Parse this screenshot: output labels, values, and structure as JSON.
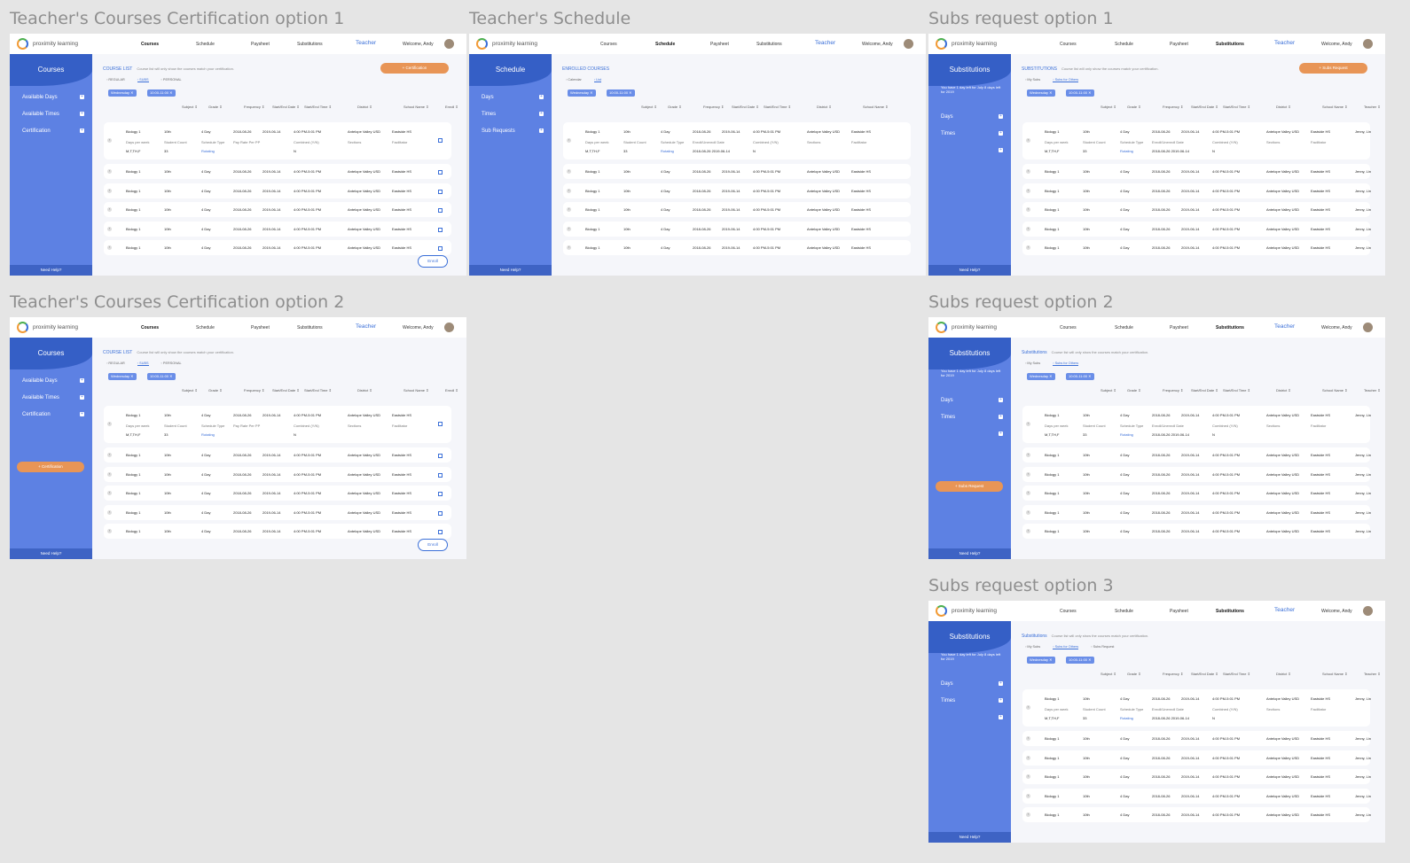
{
  "boards": [
    {
      "title": "Teacher's Courses Certification option 1",
      "nav": [
        "Courses",
        "Schedule",
        "Paysheet",
        "Substitutions"
      ],
      "active_nav": 0,
      "role": "Teacher",
      "welcome": "Welcome, Andy",
      "sidebar": {
        "title": "Courses",
        "note": "",
        "items": [
          "Available Days",
          "Available Times",
          "Certification"
        ],
        "button": ""
      },
      "section_title": "COURSE LIST",
      "section_note": "Course list will only show the courses match your certification.",
      "top_button": "+ Certification",
      "tabs": [
        "REGULAR",
        "SUBS",
        "PERSONAL"
      ],
      "active_tab": 1,
      "chips": [
        "Wednesday",
        "10:00-11:00"
      ],
      "columns": [
        "Subject",
        "Grade",
        "Frequency",
        "Start/End Date",
        "Start/End Time",
        "District",
        "School Name",
        "Enroll"
      ],
      "expanded": {
        "row": [
          "Biology 1",
          "10th",
          "4 Day",
          "2018-08-26",
          "2019-06-14",
          "4:00 PM-5:01 PM",
          "Antelope Valley USD",
          "Eastside HS"
        ],
        "labels": [
          "Days per week",
          "Student Count",
          "Schedule Type",
          "Pay Rate Per PP",
          "Combined (Y/N)",
          "Sections",
          "Facilitator"
        ],
        "values": [
          "M,T,TH,F",
          "33",
          "Rotating",
          "",
          "N",
          "",
          ""
        ]
      },
      "rows": [
        [
          "Biology 1",
          "10th",
          "4 Day",
          "2018-08-26",
          "2019-06-14",
          "4:00 PM-5:01 PM",
          "Antelope Valley USD",
          "Eastside HS"
        ],
        [
          "Biology 1",
          "10th",
          "4 Day",
          "2018-08-26",
          "2019-06-14",
          "4:00 PM-5:01 PM",
          "Antelope Valley USD",
          "Eastside HS"
        ],
        [
          "Biology 1",
          "10th",
          "4 Day",
          "2018-08-26",
          "2019-06-14",
          "4:00 PM-5:01 PM",
          "Antelope Valley USD",
          "Eastside HS"
        ],
        [
          "Biology 1",
          "10th",
          "4 Day",
          "2018-08-26",
          "2019-06-14",
          "4:00 PM-5:01 PM",
          "Antelope Valley USD",
          "Eastside HS"
        ],
        [
          "Biology 1",
          "10th",
          "4 Day",
          "2018-08-26",
          "2019-06-14",
          "4:00 PM-5:01 PM",
          "Antelope Valley USD",
          "Eastside HS"
        ]
      ],
      "checkbox": true,
      "enroll": "Enroll",
      "need_help": "Need Help?"
    },
    {
      "title": "Teacher's Schedule",
      "nav": [
        "Courses",
        "Schedule",
        "Paysheet",
        "Substitutions"
      ],
      "active_nav": 1,
      "role": "Teacher",
      "welcome": "Welcome, Andy",
      "sidebar": {
        "title": "Schedule",
        "note": "",
        "items": [
          "Days",
          "Times",
          "Sub Requests"
        ],
        "button": ""
      },
      "section_title": "ENROLLED COURSES",
      "section_note": "",
      "top_button": "",
      "tabs": [
        "Calendar",
        "List"
      ],
      "active_tab": 1,
      "chips": [
        "Wednesday",
        "10:00-11:00"
      ],
      "columns": [
        "Subject",
        "Grade",
        "Frequency",
        "Start/End Date",
        "Start/End Time",
        "District",
        "School Name"
      ],
      "expanded": {
        "row": [
          "Biology 1",
          "10th",
          "4 Day",
          "2018-08-26",
          "2019-06-14",
          "4:00 PM-5:01 PM",
          "Antelope Valley USD",
          "Eastside HS"
        ],
        "labels": [
          "Days per week",
          "Student Count",
          "Schedule Type",
          "Enroll/Unenroll Date",
          "Combined (Y/N)",
          "Sections",
          "Facilitator"
        ],
        "values": [
          "M,T,TH,F",
          "33",
          "Rotating",
          "2018-08-26  2019-06-14",
          "N",
          "",
          ""
        ]
      },
      "rows": [
        [
          "Biology 1",
          "10th",
          "4 Day",
          "2018-08-26",
          "2019-06-14",
          "4:00 PM-5:01 PM",
          "Antelope Valley USD",
          "Eastside HS"
        ],
        [
          "Biology 1",
          "10th",
          "4 Day",
          "2018-08-26",
          "2019-06-14",
          "4:00 PM-5:01 PM",
          "Antelope Valley USD",
          "Eastside HS"
        ],
        [
          "Biology 1",
          "10th",
          "4 Day",
          "2018-08-26",
          "2019-06-14",
          "4:00 PM-5:01 PM",
          "Antelope Valley USD",
          "Eastside HS"
        ],
        [
          "Biology 1",
          "10th",
          "4 Day",
          "2018-08-26",
          "2019-06-14",
          "4:00 PM-5:01 PM",
          "Antelope Valley USD",
          "Eastside HS"
        ],
        [
          "Biology 1",
          "10th",
          "4 Day",
          "2018-08-26",
          "2019-06-14",
          "4:00 PM-5:01 PM",
          "Antelope Valley USD",
          "Eastside HS"
        ]
      ],
      "checkbox": false,
      "enroll": "",
      "need_help": "Need Help?"
    },
    {
      "title": "Subs request option 1",
      "nav": [
        "Courses",
        "Schedule",
        "Paysheet",
        "Substitutions"
      ],
      "active_nav": 3,
      "role": "Teacher",
      "welcome": "Welcome, Andy",
      "sidebar": {
        "title": "Substitutions",
        "note": "You have 1 day left for July 8 days left for 2019",
        "items": [
          "Days",
          "Times",
          ""
        ],
        "button": ""
      },
      "section_title": "SUBSTITUTIONS",
      "section_note": "Course list will only show the courses match your certification.",
      "top_button": "+ Subs Request",
      "tabs": [
        "My Subs",
        "Subs for Others"
      ],
      "active_tab": 1,
      "chips": [
        "Wednesday",
        "10:00-11:00"
      ],
      "columns": [
        "Subject",
        "Grade",
        "Frequency",
        "Start/End Date",
        "Start/End Time",
        "District",
        "School Name",
        "Teacher"
      ],
      "expanded": {
        "row": [
          "Biology 1",
          "10th",
          "4 Day",
          "2018-08-26",
          "2019-06-14",
          "4:00 PM-5:01 PM",
          "Antelope Valley USD",
          "Eastside HS",
          "Jenny, Lin"
        ],
        "labels": [
          "Days per week",
          "Student Count",
          "Schedule Type",
          "Enroll/Unenroll Date",
          "Combined (Y/N)",
          "Sections",
          "Facilitator"
        ],
        "values": [
          "M,T,TH,F",
          "33",
          "Rotating",
          "2018-08-26  2019-06-14",
          "N",
          "",
          ""
        ]
      },
      "rows": [
        [
          "Biology 1",
          "10th",
          "4 Day",
          "2018-08-26",
          "2019-06-14",
          "4:00 PM-5:01 PM",
          "Antelope Valley USD",
          "Eastside HS",
          "Jenny, Lin"
        ],
        [
          "Biology 1",
          "10th",
          "4 Day",
          "2018-08-26",
          "2019-06-14",
          "4:00 PM-5:01 PM",
          "Antelope Valley USD",
          "Eastside HS",
          "Jenny, Lin"
        ],
        [
          "Biology 1",
          "10th",
          "4 Day",
          "2018-08-26",
          "2019-06-14",
          "4:00 PM-5:01 PM",
          "Antelope Valley USD",
          "Eastside HS",
          "Jenny, Lin"
        ],
        [
          "Biology 1",
          "10th",
          "4 Day",
          "2018-08-26",
          "2019-06-14",
          "4:00 PM-5:01 PM",
          "Antelope Valley USD",
          "Eastside HS",
          "Jenny, Lin"
        ],
        [
          "Biology 1",
          "10th",
          "4 Day",
          "2018-08-26",
          "2019-06-14",
          "4:00 PM-5:01 PM",
          "Antelope Valley USD",
          "Eastside HS",
          "Jenny, Lin"
        ]
      ],
      "checkbox": false,
      "enroll": "",
      "need_help": "Need Help?"
    },
    {
      "title": "Teacher's Courses Certification option 2",
      "nav": [
        "Courses",
        "Schedule",
        "Paysheet",
        "Substitutions"
      ],
      "active_nav": 0,
      "role": "Teacher",
      "welcome": "Welcome, Andy",
      "sidebar": {
        "title": "Courses",
        "note": "",
        "items": [
          "Available Days",
          "Available Times",
          "Certification"
        ],
        "button": "+ Certification"
      },
      "section_title": "COURSE LIST",
      "section_note": "Course list will only show the courses match your certification.",
      "top_button": "",
      "tabs": [
        "REGULAR",
        "SUBS",
        "PERSONAL"
      ],
      "active_tab": 1,
      "chips": [
        "Wednesday",
        "10:00-11:00"
      ],
      "columns": [
        "Subject",
        "Grade",
        "Frequency",
        "Start/End Date",
        "Start/End Time",
        "District",
        "School Name",
        "Enroll"
      ],
      "expanded": {
        "row": [
          "Biology 1",
          "10th",
          "4 Day",
          "2018-08-26",
          "2019-06-14",
          "4:00 PM-5:01 PM",
          "Antelope Valley USD",
          "Eastside HS"
        ],
        "labels": [
          "Days per week",
          "Student Count",
          "Schedule Type",
          "Pay Rate Per PP",
          "Combined (Y/N)",
          "Sections",
          "Facilitator"
        ],
        "values": [
          "M,T,TH,F",
          "33",
          "Rotating",
          "",
          "N",
          "",
          ""
        ]
      },
      "rows": [
        [
          "Biology 1",
          "10th",
          "4 Day",
          "2018-08-26",
          "2019-06-14",
          "4:00 PM-5:01 PM",
          "Antelope Valley USD",
          "Eastside HS"
        ],
        [
          "Biology 1",
          "10th",
          "4 Day",
          "2018-08-26",
          "2019-06-14",
          "4:00 PM-5:01 PM",
          "Antelope Valley USD",
          "Eastside HS"
        ],
        [
          "Biology 1",
          "10th",
          "4 Day",
          "2018-08-26",
          "2019-06-14",
          "4:00 PM-5:01 PM",
          "Antelope Valley USD",
          "Eastside HS"
        ],
        [
          "Biology 1",
          "10th",
          "4 Day",
          "2018-08-26",
          "2019-06-14",
          "4:00 PM-5:01 PM",
          "Antelope Valley USD",
          "Eastside HS"
        ],
        [
          "Biology 1",
          "10th",
          "4 Day",
          "2018-08-26",
          "2019-06-14",
          "4:00 PM-5:01 PM",
          "Antelope Valley USD",
          "Eastside HS"
        ]
      ],
      "checkbox": true,
      "enroll": "Enroll",
      "need_help": "Need Help?"
    },
    {
      "title": "Subs request option 2",
      "nav": [
        "Courses",
        "Schedule",
        "Paysheet",
        "Substitutions"
      ],
      "active_nav": 3,
      "role": "Teacher",
      "welcome": "Welcome, Andy",
      "sidebar": {
        "title": "Substitutions",
        "note": "You have 1 day left for July 8 days left for 2019",
        "items": [
          "Days",
          "Times",
          ""
        ],
        "button": "+ Subs Request"
      },
      "section_title": "Substitutions",
      "section_note": "Course list will only show the courses match your certification.",
      "top_button": "",
      "tabs": [
        "My Subs",
        "Subs for Others"
      ],
      "active_tab": 1,
      "chips": [
        "Wednesday",
        "10:00-11:00"
      ],
      "columns": [
        "Subject",
        "Grade",
        "Frequency",
        "Start/End Date",
        "Start/End Time",
        "District",
        "School Name",
        "Teacher"
      ],
      "expanded": {
        "row": [
          "Biology 1",
          "10th",
          "4 Day",
          "2018-08-26",
          "2019-06-14",
          "4:00 PM-5:01 PM",
          "Antelope Valley USD",
          "Eastside HS",
          "Jenny, Lin"
        ],
        "labels": [
          "Days per week",
          "Student Count",
          "Schedule Type",
          "Enroll/Unenroll Date",
          "Combined (Y/N)",
          "Sections",
          "Facilitator"
        ],
        "values": [
          "M,T,TH,F",
          "33",
          "Rotating",
          "2018-08-26  2019-06-14",
          "N",
          "",
          ""
        ]
      },
      "rows": [
        [
          "Biology 1",
          "10th",
          "4 Day",
          "2018-08-26",
          "2019-06-14",
          "4:00 PM-5:01 PM",
          "Antelope Valley USD",
          "Eastside HS",
          "Jenny, Lin"
        ],
        [
          "Biology 1",
          "10th",
          "4 Day",
          "2018-08-26",
          "2019-06-14",
          "4:00 PM-5:01 PM",
          "Antelope Valley USD",
          "Eastside HS",
          "Jenny, Lin"
        ],
        [
          "Biology 1",
          "10th",
          "4 Day",
          "2018-08-26",
          "2019-06-14",
          "4:00 PM-5:01 PM",
          "Antelope Valley USD",
          "Eastside HS",
          "Jenny, Lin"
        ],
        [
          "Biology 1",
          "10th",
          "4 Day",
          "2018-08-26",
          "2019-06-14",
          "4:00 PM-5:01 PM",
          "Antelope Valley USD",
          "Eastside HS",
          "Jenny, Lin"
        ],
        [
          "Biology 1",
          "10th",
          "4 Day",
          "2018-08-26",
          "2019-06-14",
          "4:00 PM-5:01 PM",
          "Antelope Valley USD",
          "Eastside HS",
          "Jenny, Lin"
        ]
      ],
      "checkbox": false,
      "enroll": "",
      "need_help": "Need Help?"
    },
    {
      "title": "Subs request option 3",
      "nav": [
        "Courses",
        "Schedule",
        "Paysheet",
        "Substitutions"
      ],
      "active_nav": 3,
      "role": "Teacher",
      "welcome": "Welcome, Andy",
      "sidebar": {
        "title": "Substitutions",
        "note": "You have 1 day left for July 8 days left for 2019",
        "items": [
          "Days",
          "Times",
          ""
        ],
        "button": ""
      },
      "section_title": "Substitutions",
      "section_note": "Course list will only show the courses match your certification.",
      "top_button": "",
      "tabs": [
        "My Subs",
        "Subs for Others",
        "Subs Request"
      ],
      "active_tab": 1,
      "chips": [
        "Wednesday",
        "10:00-11:00"
      ],
      "columns": [
        "Subject",
        "Grade",
        "Frequency",
        "Start/End Date",
        "Start/End Time",
        "District",
        "School Name",
        "Teacher"
      ],
      "expanded": {
        "row": [
          "Biology 1",
          "10th",
          "4 Day",
          "2018-08-26",
          "2019-06-14",
          "4:00 PM-5:01 PM",
          "Antelope Valley USD",
          "Eastside HS",
          "Jenny, Lin"
        ],
        "labels": [
          "Days per week",
          "Student Count",
          "Schedule Type",
          "Enroll/Unenroll Date",
          "Combined (Y/N)",
          "Sections",
          "Facilitator"
        ],
        "values": [
          "M,T,TH,F",
          "33",
          "Rotating",
          "2018-08-26  2019-06-14",
          "N",
          "",
          ""
        ]
      },
      "rows": [
        [
          "Biology 1",
          "10th",
          "4 Day",
          "2018-08-26",
          "2019-06-14",
          "4:00 PM-5:01 PM",
          "Antelope Valley USD",
          "Eastside HS",
          "Jenny, Lin"
        ],
        [
          "Biology 1",
          "10th",
          "4 Day",
          "2018-08-26",
          "2019-06-14",
          "4:00 PM-5:01 PM",
          "Antelope Valley USD",
          "Eastside HS",
          "Jenny, Lin"
        ],
        [
          "Biology 1",
          "10th",
          "4 Day",
          "2018-08-26",
          "2019-06-14",
          "4:00 PM-5:01 PM",
          "Antelope Valley USD",
          "Eastside HS",
          "Jenny, Lin"
        ],
        [
          "Biology 1",
          "10th",
          "4 Day",
          "2018-08-26",
          "2019-06-14",
          "4:00 PM-5:01 PM",
          "Antelope Valley USD",
          "Eastside HS",
          "Jenny, Lin"
        ],
        [
          "Biology 1",
          "10th",
          "4 Day",
          "2018-08-26",
          "2019-06-14",
          "4:00 PM-5:01 PM",
          "Antelope Valley USD",
          "Eastside HS",
          "Jenny, Lin"
        ]
      ],
      "checkbox": false,
      "enroll": "",
      "need_help": "Need Help?"
    }
  ],
  "brand": "proximity learning"
}
